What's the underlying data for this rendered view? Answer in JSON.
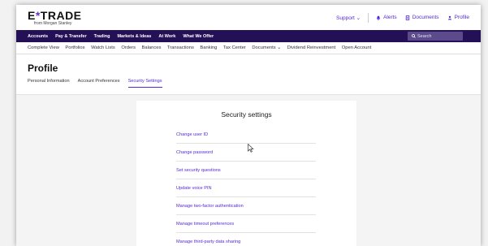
{
  "brand": {
    "logo_text_a": "E",
    "logo_text_star": "*",
    "logo_text_b": "TRADE",
    "logo_sub": "from Morgan Stanley"
  },
  "utility": {
    "support": "Support ⌄",
    "alerts": "Alerts",
    "documents": "Documents",
    "profile": "Profile"
  },
  "main_nav": [
    "Accounts",
    "Pay & Transfer",
    "Trading",
    "Markets & Ideas",
    "At Work",
    "What We Offer"
  ],
  "search": {
    "placeholder": "Search"
  },
  "sub_nav": [
    "Complete View",
    "Portfolios",
    "Watch Lists",
    "Orders",
    "Balances",
    "Transactions",
    "Banking",
    "Tax Center",
    "Documents ⌄",
    "Dividend Reinvestment",
    "Open Account"
  ],
  "page": {
    "title": "Profile",
    "tabs": [
      "Personal Information",
      "Account Preferences",
      "Security Settings"
    ],
    "active_tab": "Security Settings"
  },
  "card": {
    "title": "Security settings",
    "links": [
      "Change user ID",
      "Change password",
      "Set security questions",
      "Update voice PIN",
      "Manage two-factor authentication",
      "Manage timeout preferences",
      "Manage third-party data sharing"
    ]
  },
  "colors": {
    "nav_bg": "#241056",
    "accent": "#5627d8"
  }
}
